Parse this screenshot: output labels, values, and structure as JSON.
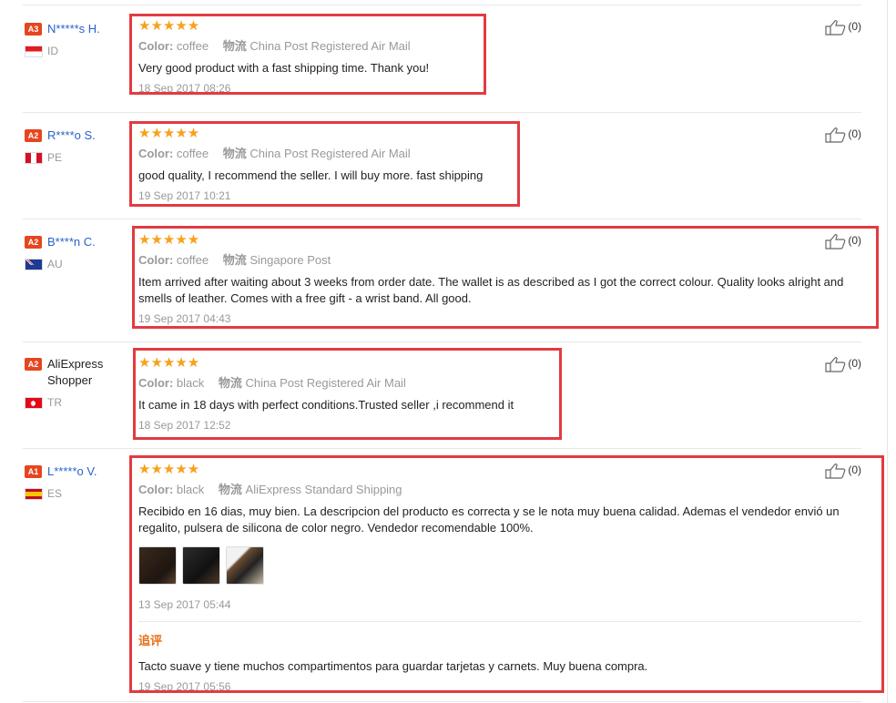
{
  "reviews": [
    {
      "level": "A3",
      "user": "N*****s H.",
      "country": "ID",
      "stars": "★★★★★",
      "color_label": "Color:",
      "color": "coffee",
      "ship_label": "物流",
      "shipping": "China Post Registered Air Mail",
      "text": "Very good product with a fast shipping time. Thank you!",
      "date": "18 Sep 2017 08:26",
      "helpful": "(0)"
    },
    {
      "level": "A2",
      "user": "R****o S.",
      "country": "PE",
      "stars": "★★★★★",
      "color_label": "Color:",
      "color": "coffee",
      "ship_label": "物流",
      "shipping": "China Post Registered Air Mail",
      "text": "good quality, I recommend the seller. I will buy more. fast shipping",
      "date": "19 Sep 2017 10:21",
      "helpful": "(0)"
    },
    {
      "level": "A2",
      "user": "B****n C.",
      "country": "AU",
      "stars": "★★★★★",
      "color_label": "Color:",
      "color": "coffee",
      "ship_label": "物流",
      "shipping": "Singapore Post",
      "text": "Item arrived after waiting about 3 weeks from order date. The wallet is as described as I got the correct colour. Quality looks alright and smells of leather. Comes with a free gift - a wrist band. All good.",
      "date": "19 Sep 2017 04:43",
      "helpful": "(0)"
    },
    {
      "level": "A2",
      "user": "AliExpress Shopper",
      "country": "TR",
      "stars": "★★★★★",
      "color_label": "Color:",
      "color": "black",
      "ship_label": "物流",
      "shipping": "China Post Registered Air Mail",
      "text": "It came in 18 days with perfect conditions.Trusted seller ,i recommend it",
      "date": "18 Sep 2017 12:52",
      "helpful": "(0)"
    },
    {
      "level": "A1",
      "user": "L*****o V.",
      "country": "ES",
      "stars": "★★★★★",
      "color_label": "Color:",
      "color": "black",
      "ship_label": "物流",
      "shipping": "AliExpress Standard Shipping",
      "text": "Recibido en 16 dias, muy bien. La descripcion del producto es correcta y se le nota muy buena calidad. Ademas el vendedor envió un regalito, pulsera de silicona de color negro. Vendedor recomendable 100%.",
      "date": "13 Sep 2017 05:44",
      "helpful": "(0)",
      "additional_label": "追评",
      "additional_text": "Tacto suave y tiene muchos compartimentos para guardar tarjetas y carnets. Muy buena compra.",
      "additional_date": "19 Sep 2017 05:56"
    }
  ],
  "colors": {
    "highlight": "#e23b41",
    "star": "#f8a11a",
    "username": "#2a62c9",
    "level_badge": "#e5461f"
  }
}
